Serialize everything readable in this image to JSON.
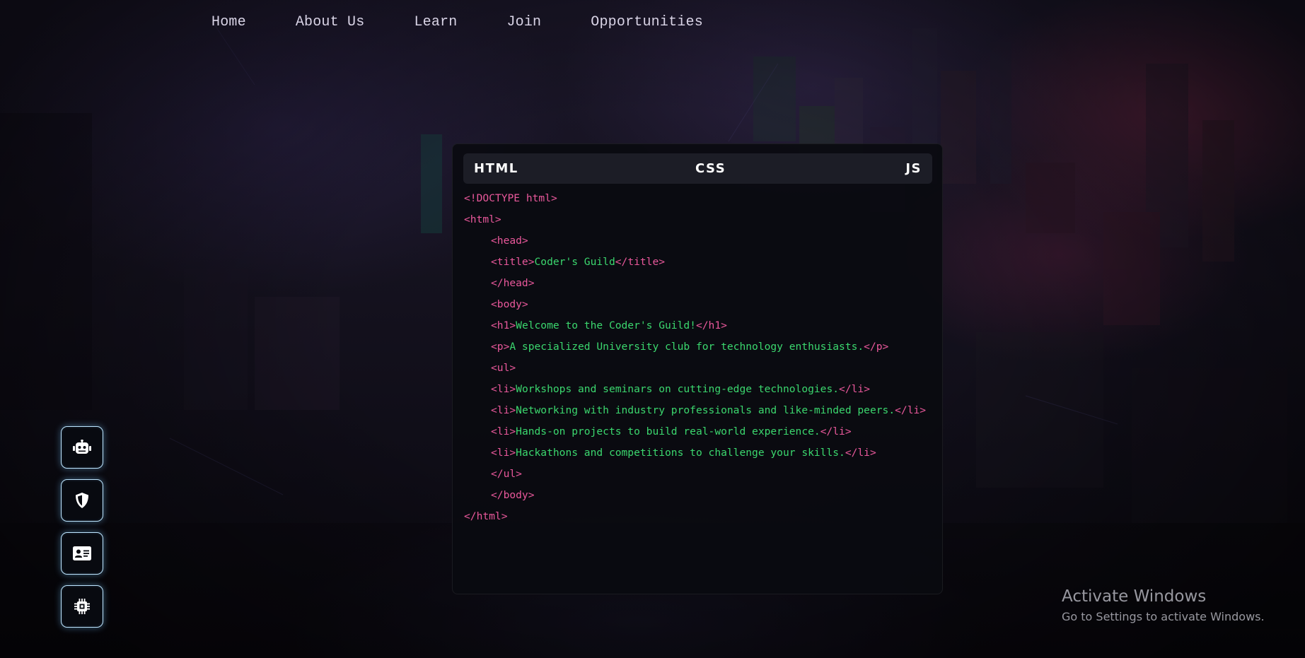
{
  "nav": {
    "items": [
      {
        "label": "Home"
      },
      {
        "label": "About Us"
      },
      {
        "label": "Learn"
      },
      {
        "label": "Join"
      },
      {
        "label": "Opportunities"
      }
    ]
  },
  "editor": {
    "tabs": [
      {
        "label": "HTML"
      },
      {
        "label": "CSS"
      },
      {
        "label": "JS"
      }
    ],
    "lines": [
      [
        {
          "t": "tag",
          "v": "<!DOCTYPE html>"
        }
      ],
      [
        {
          "t": "tag",
          "v": "<html>"
        }
      ],
      [
        {
          "t": "tag",
          "v": "<head>"
        }
      ],
      [
        {
          "t": "tag",
          "v": "<title>"
        },
        {
          "t": "txt",
          "v": "Coder's Guild"
        },
        {
          "t": "tag",
          "v": "</title>"
        }
      ],
      [
        {
          "t": "tag",
          "v": "</head>"
        }
      ],
      [
        {
          "t": "tag",
          "v": "<body>"
        }
      ],
      [
        {
          "t": "tag",
          "v": "<h1>"
        },
        {
          "t": "txt",
          "v": "Welcome to the Coder's Guild!"
        },
        {
          "t": "tag",
          "v": "</h1>"
        }
      ],
      [
        {
          "t": "tag",
          "v": "<p>"
        },
        {
          "t": "txt",
          "v": "A specialized University club for technology enthusiasts."
        },
        {
          "t": "tag",
          "v": "</p>"
        }
      ],
      [
        {
          "t": "tag",
          "v": "<ul>"
        }
      ],
      [
        {
          "t": "tag",
          "v": "<li>"
        },
        {
          "t": "txt",
          "v": "Workshops and seminars on cutting-edge technologies."
        },
        {
          "t": "tag",
          "v": "</li>"
        }
      ],
      [
        {
          "t": "tag",
          "v": "<li>"
        },
        {
          "t": "txt",
          "v": "Networking with industry professionals and like-minded peers."
        },
        {
          "t": "tag",
          "v": "</li>"
        }
      ],
      [
        {
          "t": "tag",
          "v": "<li>"
        },
        {
          "t": "txt",
          "v": "Hands-on projects to build real-world experience."
        },
        {
          "t": "tag",
          "v": "</li>"
        }
      ],
      [
        {
          "t": "tag",
          "v": "<li>"
        },
        {
          "t": "txt",
          "v": "Hackathons and competitions to challenge your skills."
        },
        {
          "t": "tag",
          "v": "</li>"
        }
      ],
      [
        {
          "t": "tag",
          "v": "</ul>"
        }
      ],
      [
        {
          "t": "tag",
          "v": "</body>"
        }
      ],
      [
        {
          "t": "tag",
          "v": "</html>"
        }
      ]
    ],
    "colors": {
      "tag": "#e9589b",
      "text": "#3bd76e"
    }
  },
  "sidebar": {
    "buttons": [
      {
        "icon": "robot-icon"
      },
      {
        "icon": "shield-icon"
      },
      {
        "icon": "id-card-icon"
      },
      {
        "icon": "microchip-icon"
      }
    ]
  },
  "watermark": {
    "title": "Activate Windows",
    "subtitle": "Go to Settings to activate Windows."
  }
}
